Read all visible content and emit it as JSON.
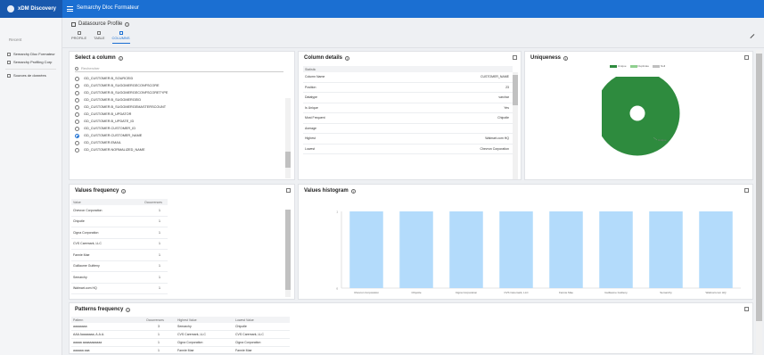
{
  "app": {
    "brand": "xDM Discovery",
    "title": "Semarchy Dloc Formateur"
  },
  "sidebar": {
    "section": "Recent",
    "items": [
      {
        "label": "Semarchy Dloc Formateur"
      },
      {
        "label": "Semarchy Profiling Corp"
      },
      {
        "label": "Sources de données"
      }
    ]
  },
  "page": {
    "title": "Datasource Profile"
  },
  "tabs": [
    {
      "label": "PROFILE",
      "active": false
    },
    {
      "label": "TABLE",
      "active": false
    },
    {
      "label": "COLUMNS",
      "active": true
    }
  ],
  "select_column": {
    "title": "Select a column",
    "search_placeholder": "Rechercher",
    "columns": [
      {
        "name": "GD_CUSTOMER.B_SOURCEID",
        "selected": false
      },
      {
        "name": "GD_CUSTOMER.B_SUGGMERGECONFSCORE",
        "selected": false
      },
      {
        "name": "GD_CUSTOMER.B_SUGGMERGECONFSCORETYPE",
        "selected": false
      },
      {
        "name": "GD_CUSTOMER.B_SUGGMERGEID",
        "selected": false
      },
      {
        "name": "GD_CUSTOMER.B_SUGGMERGEMASTERSCOUNT",
        "selected": false
      },
      {
        "name": "GD_CUSTOMER.B_UPDATOR",
        "selected": false
      },
      {
        "name": "GD_CUSTOMER.B_UPDATE_ID",
        "selected": false
      },
      {
        "name": "GD_CUSTOMER.CUSTOMER_ID",
        "selected": false
      },
      {
        "name": "GD_CUSTOMER.CUSTOMER_NAME",
        "selected": true
      },
      {
        "name": "GD_CUSTOMER.EMAIL",
        "selected": false
      },
      {
        "name": "GD_CUSTOMER.NORMALIZED_NAME",
        "selected": false
      }
    ]
  },
  "column_details": {
    "title": "Column details",
    "header": "Statistic",
    "rows": [
      {
        "label": "Column Name",
        "value": "CUSTOMER_NAME"
      },
      {
        "label": "Position",
        "value": "23"
      },
      {
        "label": "Datatype",
        "value": "varchar"
      },
      {
        "label": "Is Unique",
        "value": "Yes"
      },
      {
        "label": "Most Frequent",
        "value": "Chipotle"
      },
      {
        "label": "Average",
        "value": ""
      },
      {
        "label": "Highest",
        "value": "Walmart.com HQ"
      },
      {
        "label": "Lowest",
        "value": "Chevron Corporation"
      }
    ]
  },
  "uniqueness": {
    "title": "Uniqueness",
    "legend": [
      {
        "label": "Unique",
        "color": "#2e8b3e"
      },
      {
        "label": "Duplicate",
        "color": "#8fd08f"
      },
      {
        "label": "Null",
        "color": "#bfbfbf"
      }
    ],
    "slice_label": "Unique",
    "values": {
      "unique": 1.0,
      "duplicate": 0.0,
      "null": 0.0
    }
  },
  "values_frequency": {
    "title": "Values frequency",
    "headers": [
      "Value",
      "Occurrences"
    ],
    "rows": [
      {
        "value": "Chevron Corporation",
        "count": "1"
      },
      {
        "value": "Chipotle",
        "count": "1"
      },
      {
        "value": "Cigna Corporation",
        "count": "1"
      },
      {
        "value": "CVS Caremark, LLC",
        "count": "1"
      },
      {
        "value": "Fannie Mae",
        "count": "1"
      },
      {
        "value": "Guillaume Guitteny",
        "count": "1"
      },
      {
        "value": "Semarchy",
        "count": "1"
      },
      {
        "value": "Walmart.com HQ",
        "count": "1"
      }
    ]
  },
  "chart_data": {
    "type": "bar",
    "title": "Values histogram",
    "categories": [
      "Chevron Corporation",
      "Chipotle",
      "Cigna Corporation",
      "CVS Caremark, LLC",
      "Fannie Mae",
      "Guillaume Guitteny",
      "Semarchy",
      "Walmart.com HQ"
    ],
    "values": [
      1,
      1,
      1,
      1,
      1,
      1,
      1,
      1
    ],
    "ylim": [
      0,
      1
    ],
    "yticks": [
      "1",
      "0"
    ],
    "color": "#b3dbfb"
  },
  "patterns_frequency": {
    "title": "Patterns frequency",
    "headers": [
      "Pattern",
      "Occurrences",
      "Highest Value",
      "Lowest Value"
    ],
    "rows": [
      {
        "pattern": "aaaaaaaa",
        "count": "3",
        "highest": "Semarchy",
        "lowest": "Chipotle"
      },
      {
        "pattern": "AAA Aaaaaaaa, A.A.A.",
        "count": "1",
        "highest": "CVS Caremark, LLC",
        "lowest": "CVS Caremark, LLC"
      },
      {
        "pattern": "aaaaa aaaaaaaaaaa",
        "count": "1",
        "highest": "Cigna Corporation",
        "lowest": "Cigna Corporation"
      },
      {
        "pattern": "aaaaaa aaa",
        "count": "1",
        "highest": "Fannie Mae",
        "lowest": "Fannie Mae"
      }
    ]
  }
}
